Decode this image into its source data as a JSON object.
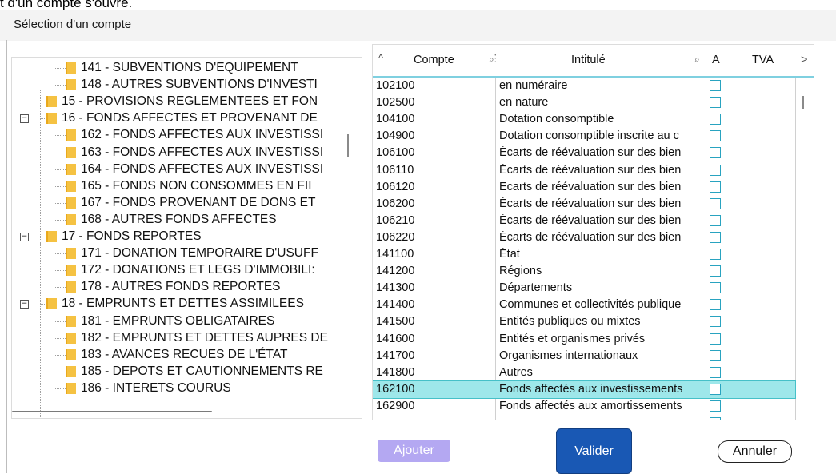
{
  "document": {
    "fragment_text": "t d'un compte s'ouvre."
  },
  "dialog": {
    "title": "Sélection d'un compte"
  },
  "tree": {
    "items": [
      {
        "label": "141 - SUBVENTIONS D'EQUIPEMENT"
      },
      {
        "label": "148 - AUTRES SUBVENTIONS D'INVESTI"
      },
      {
        "label": "15 - PROVISIONS REGLEMENTEES ET FON"
      },
      {
        "label": "16 - FONDS AFFECTES ET PROVENANT DE",
        "expander": "−"
      },
      {
        "label": "162 - FONDS AFFECTES AUX INVESTISSI"
      },
      {
        "label": "163 - FONDS AFFECTES AUX INVESTISSI"
      },
      {
        "label": "164 - FONDS AFFECTES AUX INVESTISSI"
      },
      {
        "label": "165 - FONDS NON CONSOMMES EN FII"
      },
      {
        "label": "167 - FONDS PROVENANT DE DONS ET"
      },
      {
        "label": "168 - AUTRES FONDS AFFECTES"
      },
      {
        "label": "17 - FONDS REPORTES",
        "expander": "−"
      },
      {
        "label": "171 - DONATION TEMPORAIRE D'USUFF"
      },
      {
        "label": "172 - DONATIONS ET LEGS D'IMMOBILI:"
      },
      {
        "label": "178 - AUTRES FONDS REPORTES"
      },
      {
        "label": "18 - EMPRUNTS ET DETTES ASSIMILEES",
        "expander": "−"
      },
      {
        "label": "181 - EMPRUNTS OBLIGATAIRES"
      },
      {
        "label": "182 - EMPRUNTS ET DETTES AUPRES DE"
      },
      {
        "label": "183 - AVANCES RECUES DE L'ÉTAT"
      },
      {
        "label": "185 - DEPOTS ET CAUTIONNEMENTS RE"
      },
      {
        "label": "186 - INTERETS COURUS"
      }
    ]
  },
  "grid": {
    "columns": {
      "sort_icon": "^",
      "compte": "Compte",
      "compte_search_icon": "⌕⁝",
      "intitule": "Intitulé",
      "intitule_search_icon": "⌕",
      "a": "A",
      "tva": "TVA",
      "more_icon": ">"
    },
    "rows": [
      {
        "compte": "102100",
        "intitule": "en numéraire"
      },
      {
        "compte": "102500",
        "intitule": "en nature"
      },
      {
        "compte": "104100",
        "intitule": "Dotation consomptible"
      },
      {
        "compte": "104900",
        "intitule": "Dotation consomptible inscrite au c"
      },
      {
        "compte": "106100",
        "intitule": "Écarts de réévaluation sur des bien"
      },
      {
        "compte": "106110",
        "intitule": "Écarts de réévaluation sur des bien"
      },
      {
        "compte": "106120",
        "intitule": "Écarts de réévaluation sur des bien"
      },
      {
        "compte": "106200",
        "intitule": "Écarts de réévaluation sur des bien"
      },
      {
        "compte": "106210",
        "intitule": "Écarts de réévaluation sur des bien"
      },
      {
        "compte": "106220",
        "intitule": "Écarts de réévaluation sur des bien"
      },
      {
        "compte": "141100",
        "intitule": "État"
      },
      {
        "compte": "141200",
        "intitule": "Régions"
      },
      {
        "compte": "141300",
        "intitule": "Départements"
      },
      {
        "compte": "141400",
        "intitule": "Communes et collectivités publique"
      },
      {
        "compte": "141500",
        "intitule": "Entités publiques ou mixtes"
      },
      {
        "compte": "141600",
        "intitule": "Entités et organismes privés"
      },
      {
        "compte": "141700",
        "intitule": "Organismes internationaux"
      },
      {
        "compte": "141800",
        "intitule": "Autres"
      },
      {
        "compte": "162100",
        "intitule": "Fonds affectés aux investissements",
        "selected": true
      },
      {
        "compte": "162900",
        "intitule": "Fonds affectés aux amortissements"
      }
    ]
  },
  "buttons": {
    "ajouter": "Ajouter",
    "valider": "Valider",
    "annuler": "Annuler"
  },
  "colors": {
    "title_bar": "#f3f3f3",
    "selected_row": "#9ee7ea",
    "header_underline": "#7fd0e0",
    "checkbox_border": "#29a3c0",
    "valider_bg": "#1958b4",
    "ajouter_bg": "#b4a8f2",
    "folder": "#f5c242"
  }
}
